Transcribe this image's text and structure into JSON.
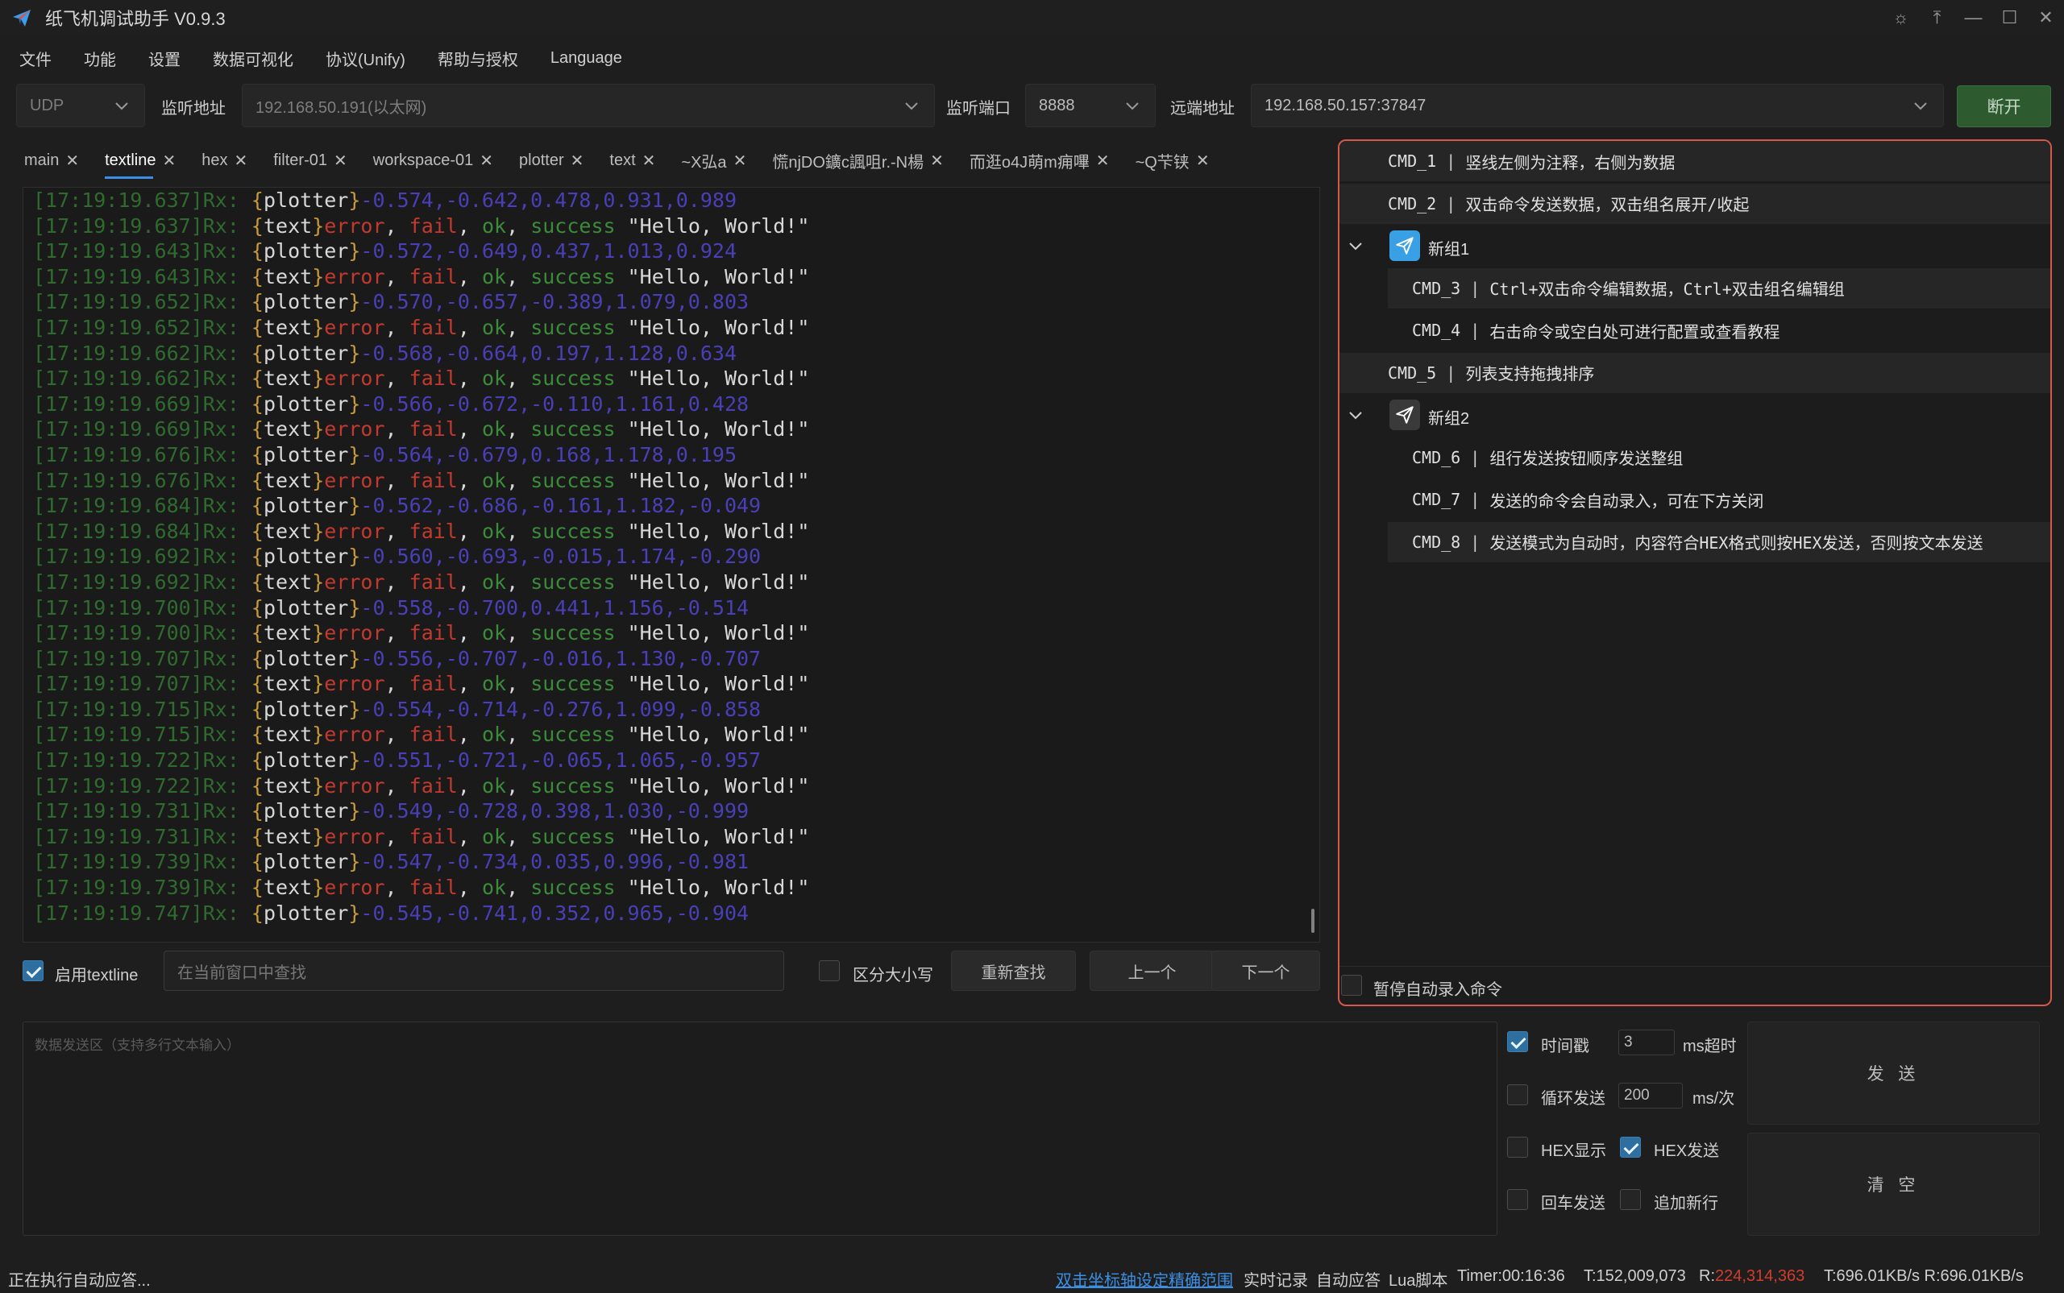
{
  "window": {
    "title": "纸飞机调试助手 V0.9.3",
    "controls": [
      "☼",
      "⤒",
      "—",
      "☐",
      "✕"
    ]
  },
  "menu": [
    "文件",
    "功能",
    "设置",
    "数据可视化",
    "协议(Unify)",
    "帮助与授权",
    "Language"
  ],
  "connection": {
    "protocol": "UDP",
    "listen_addr_label": "监听地址",
    "listen_addr": "192.168.50.191(以太网)",
    "listen_port_label": "监听端口",
    "listen_port": "8888",
    "remote_addr_label": "远端地址",
    "remote_addr": "192.168.50.157:37847",
    "disconnect_label": "断开"
  },
  "tabs": [
    "main",
    "textline",
    "hex",
    "filter-01",
    "workspace-01",
    "plotter",
    "text",
    "~X弘a",
    "慌njDO鑛c諷咀r.-N楊",
    "而逛o4J萌m痈嗶",
    "~Q芐铗"
  ],
  "active_tab": 1,
  "log": [
    {
      "ts": "[17:19:19.637]Rx:",
      "kind": "plotter",
      "vals": "-0.574,-0.642,0.478,0.931,0.989"
    },
    {
      "ts": "[17:19:19.637]Rx:",
      "kind": "text"
    },
    {
      "ts": "[17:19:19.643]Rx:",
      "kind": "plotter",
      "vals": "-0.572,-0.649,0.437,1.013,0.924"
    },
    {
      "ts": "[17:19:19.643]Rx:",
      "kind": "text"
    },
    {
      "ts": "[17:19:19.652]Rx:",
      "kind": "plotter",
      "vals": "-0.570,-0.657,-0.389,1.079,0.803"
    },
    {
      "ts": "[17:19:19.652]Rx:",
      "kind": "text"
    },
    {
      "ts": "[17:19:19.662]Rx:",
      "kind": "plotter",
      "vals": "-0.568,-0.664,0.197,1.128,0.634"
    },
    {
      "ts": "[17:19:19.662]Rx:",
      "kind": "text"
    },
    {
      "ts": "[17:19:19.669]Rx:",
      "kind": "plotter",
      "vals": "-0.566,-0.672,-0.110,1.161,0.428"
    },
    {
      "ts": "[17:19:19.669]Rx:",
      "kind": "text"
    },
    {
      "ts": "[17:19:19.676]Rx:",
      "kind": "plotter",
      "vals": "-0.564,-0.679,0.168,1.178,0.195"
    },
    {
      "ts": "[17:19:19.676]Rx:",
      "kind": "text"
    },
    {
      "ts": "[17:19:19.684]Rx:",
      "kind": "plotter",
      "vals": "-0.562,-0.686,-0.161,1.182,-0.049"
    },
    {
      "ts": "[17:19:19.684]Rx:",
      "kind": "text"
    },
    {
      "ts": "[17:19:19.692]Rx:",
      "kind": "plotter",
      "vals": "-0.560,-0.693,-0.015,1.174,-0.290"
    },
    {
      "ts": "[17:19:19.692]Rx:",
      "kind": "text"
    },
    {
      "ts": "[17:19:19.700]Rx:",
      "kind": "plotter",
      "vals": "-0.558,-0.700,0.441,1.156,-0.514"
    },
    {
      "ts": "[17:19:19.700]Rx:",
      "kind": "text"
    },
    {
      "ts": "[17:19:19.707]Rx:",
      "kind": "plotter",
      "vals": "-0.556,-0.707,-0.016,1.130,-0.707"
    },
    {
      "ts": "[17:19:19.707]Rx:",
      "kind": "text"
    },
    {
      "ts": "[17:19:19.715]Rx:",
      "kind": "plotter",
      "vals": "-0.554,-0.714,-0.276,1.099,-0.858"
    },
    {
      "ts": "[17:19:19.715]Rx:",
      "kind": "text"
    },
    {
      "ts": "[17:19:19.722]Rx:",
      "kind": "plotter",
      "vals": "-0.551,-0.721,-0.065,1.065,-0.957"
    },
    {
      "ts": "[17:19:19.722]Rx:",
      "kind": "text"
    },
    {
      "ts": "[17:19:19.731]Rx:",
      "kind": "plotter",
      "vals": "-0.549,-0.728,0.398,1.030,-0.999"
    },
    {
      "ts": "[17:19:19.731]Rx:",
      "kind": "text"
    },
    {
      "ts": "[17:19:19.739]Rx:",
      "kind": "plotter",
      "vals": "-0.547,-0.734,0.035,0.996,-0.981"
    },
    {
      "ts": "[17:19:19.739]Rx:",
      "kind": "text"
    },
    {
      "ts": "[17:19:19.747]Rx:",
      "kind": "plotter",
      "vals": "-0.545,-0.741,0.352,0.965,-0.904"
    }
  ],
  "log_text_tokens": {
    "plotter_tag": "plotter",
    "text_tag": "text",
    "error": "error",
    "fail": "fail",
    "ok": "ok",
    "success": "success",
    "hello": "\"Hello, World!\""
  },
  "search": {
    "enable_label": "启用textline",
    "enable_checked": true,
    "placeholder": "在当前窗口中查找",
    "case_label": "区分大小写",
    "case_checked": false,
    "research": "重新查找",
    "prev": "上一个",
    "next": "下一个"
  },
  "commands": [
    {
      "type": "cmd",
      "id": "CMD_1",
      "text": "竖线左侧为注释，右侧为数据",
      "indent": 0,
      "bg": true
    },
    {
      "type": "cmd",
      "id": "CMD_2",
      "text": "双击命令发送数据，双击组名展开/收起",
      "indent": 0,
      "bg": true
    },
    {
      "type": "group",
      "name": "新组1",
      "icon_color": "#3aa0e6"
    },
    {
      "type": "cmd",
      "id": "CMD_3",
      "text": "Ctrl+双击命令编辑数据，Ctrl+双击组名编辑组",
      "indent": 1,
      "bg": true
    },
    {
      "type": "cmd",
      "id": "CMD_4",
      "text": "右击命令或空白处可进行配置或查看教程",
      "indent": 1,
      "bg": false
    },
    {
      "type": "cmd",
      "id": "CMD_5",
      "text": "列表支持拖拽排序",
      "indent": 0,
      "bg": true
    },
    {
      "type": "group",
      "name": "新组2",
      "icon_color": "#3a3a3a"
    },
    {
      "type": "cmd",
      "id": "CMD_6",
      "text": "组行发送按钮顺序发送整组",
      "indent": 1,
      "bg": false
    },
    {
      "type": "cmd",
      "id": "CMD_7",
      "text": "发送的命令会自动录入，可在下方关闭",
      "indent": 1,
      "bg": false
    },
    {
      "type": "cmd",
      "id": "CMD_8",
      "text": "发送模式为自动时，内容符合HEX格式则按HEX发送，否则按文本发送",
      "indent": 1,
      "bg": true
    }
  ],
  "pause_record_label": "暂停自动录入命令",
  "send": {
    "placeholder": "数据发送区（支持多行文本输入）",
    "timestamp_label": "时间戳",
    "timestamp_checked": true,
    "timeout_value": "3",
    "timeout_unit": "ms超时",
    "loop_label": "循环发送",
    "loop_checked": false,
    "loop_value": "200",
    "loop_unit": "ms/次",
    "hex_show_label": "HEX显示",
    "hex_show_checked": false,
    "hex_send_label": "HEX发送",
    "hex_send_checked": true,
    "enter_send_label": "回车发送",
    "enter_send_checked": false,
    "append_newline_label": "追加新行",
    "append_newline_checked": false,
    "send_button": "发 送",
    "clear_button": "清 空"
  },
  "status": {
    "left": "正在执行自动应答...",
    "axis_hint": "双击坐标轴设定精确范围",
    "realtime": "实时记录",
    "auto_reply": "自动应答",
    "lua": "Lua脚本",
    "timer": "Timer:00:16:36",
    "tx": "T:152,009,073",
    "rx_label": "R:",
    "rx_value": "224,314,363",
    "speed": "T:696.01KB/s R:696.01KB/s"
  },
  "colors": {
    "accent": "#3d8ee6",
    "panel_border": "#d7584a",
    "disconnect_bg": "#2d5a2f",
    "rx_red": "#d33c2c"
  }
}
